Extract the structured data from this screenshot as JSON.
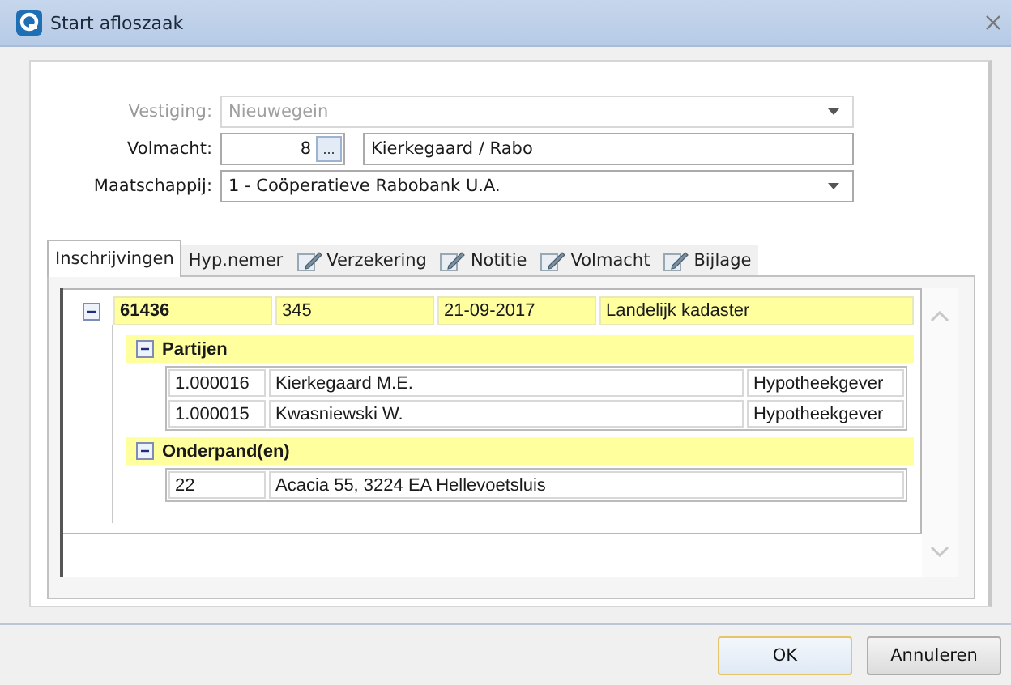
{
  "window": {
    "title": "Start afloszaak"
  },
  "form": [
    {
      "kind": "dropdown",
      "label": "Vestiging:",
      "value": "Nieuwegein",
      "disabled": true
    },
    {
      "kind": "lookup",
      "label": "Volmacht:",
      "number": "8",
      "button": "...",
      "value": "Kierkegaard / Rabo",
      "disabled": false
    },
    {
      "kind": "dropdown",
      "label": "Maatschappij:",
      "value": "1 - Coöperatieve Rabobank U.A.",
      "disabled": false
    }
  ],
  "tabs": [
    {
      "label": "Inschrijvingen",
      "selected": true,
      "kind": "plain"
    },
    {
      "label": "Hyp.nemer",
      "selected": false,
      "kind": "plain"
    },
    {
      "label": "Verzekering",
      "selected": false,
      "kind": "icon"
    },
    {
      "label": "Notitie",
      "selected": false,
      "kind": "icon"
    },
    {
      "label": "Volmacht",
      "selected": false,
      "kind": "icon"
    },
    {
      "label": "Bijlage",
      "selected": false,
      "kind": "icon"
    }
  ],
  "record": {
    "expanded": true,
    "cells": [
      "61436",
      "345",
      "21-09-2017",
      "Landelijk kadaster"
    ],
    "groups": [
      {
        "title": "Partijen",
        "expanded": true,
        "rows": [
          [
            "1.000016",
            "Kierkegaard M.E.",
            "Hypotheekgever"
          ],
          [
            "1.000015",
            "Kwasniewski W.",
            "Hypotheekgever"
          ]
        ]
      },
      {
        "title": "Onderpand(en)",
        "expanded": true,
        "rows": [
          [
            "22",
            "Acacia 55, 3224 EA Hellevoetsluis"
          ]
        ]
      }
    ]
  },
  "buttons": [
    {
      "label": "OK",
      "default": true
    },
    {
      "label": "Annuleren",
      "default": false
    }
  ]
}
